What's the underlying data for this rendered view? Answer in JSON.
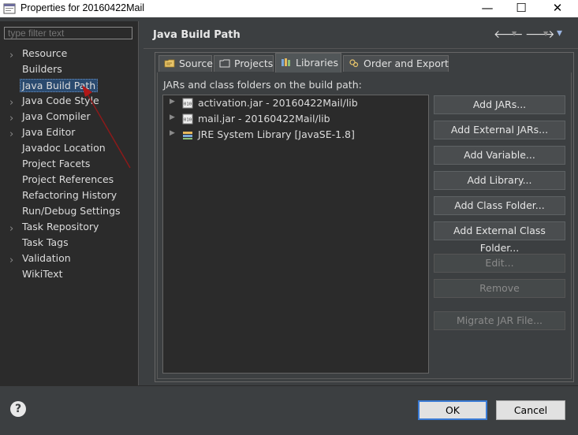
{
  "window": {
    "title": "Properties for 20160422Mail",
    "minimize": "—",
    "maximize": "☐",
    "close": "✕"
  },
  "sidebar": {
    "filter_placeholder": "type filter text",
    "items": [
      {
        "label": "Resource",
        "expandable": true
      },
      {
        "label": "Builders",
        "expandable": false
      },
      {
        "label": "Java Build Path",
        "expandable": false,
        "selected": true
      },
      {
        "label": "Java Code Style",
        "expandable": true
      },
      {
        "label": "Java Compiler",
        "expandable": true
      },
      {
        "label": "Java Editor",
        "expandable": true
      },
      {
        "label": "Javadoc Location",
        "expandable": false
      },
      {
        "label": "Project Facets",
        "expandable": false
      },
      {
        "label": "Project References",
        "expandable": false
      },
      {
        "label": "Refactoring History",
        "expandable": false
      },
      {
        "label": "Run/Debug Settings",
        "expandable": false
      },
      {
        "label": "Task Repository",
        "expandable": true
      },
      {
        "label": "Task Tags",
        "expandable": false
      },
      {
        "label": "Validation",
        "expandable": true
      },
      {
        "label": "WikiText",
        "expandable": false
      }
    ]
  },
  "header": {
    "title": "Java Build Path",
    "back": "🡐",
    "forward": "🡒",
    "menu": "▾"
  },
  "tabs": [
    {
      "label": "Source",
      "icon": "source-folder-icon"
    },
    {
      "label": "Projects",
      "icon": "projects-icon"
    },
    {
      "label": "Libraries",
      "icon": "libraries-icon",
      "active": true
    },
    {
      "label": "Order and Export",
      "icon": "order-export-icon"
    }
  ],
  "libraries": {
    "caption": "JARs and class folders on the build path:",
    "entries": [
      {
        "label": "activation.jar - 20160422Mail/lib",
        "icon": "jar-icon"
      },
      {
        "label": "mail.jar - 20160422Mail/lib",
        "icon": "jar-icon"
      },
      {
        "label": "JRE System Library [JavaSE-1.8]",
        "icon": "library-icon"
      }
    ],
    "buttons": {
      "add_jars": "Add JARs...",
      "add_external_jars": "Add External JARs...",
      "add_variable": "Add Variable...",
      "add_library": "Add Library...",
      "add_class_folder": "Add Class Folder...",
      "add_external_class_folder": "Add External Class Folder...",
      "edit": "Edit...",
      "remove": "Remove",
      "migrate_jar": "Migrate JAR File..."
    }
  },
  "footer": {
    "help": "?",
    "ok": "OK",
    "cancel": "Cancel"
  },
  "colors": {
    "background": "#3c3f41",
    "tree_background": "#2b2b2b",
    "selection": "#2a4a6f",
    "default_button_border": "#3a7bd5",
    "annotation_arrow": "#8b1a1a"
  }
}
